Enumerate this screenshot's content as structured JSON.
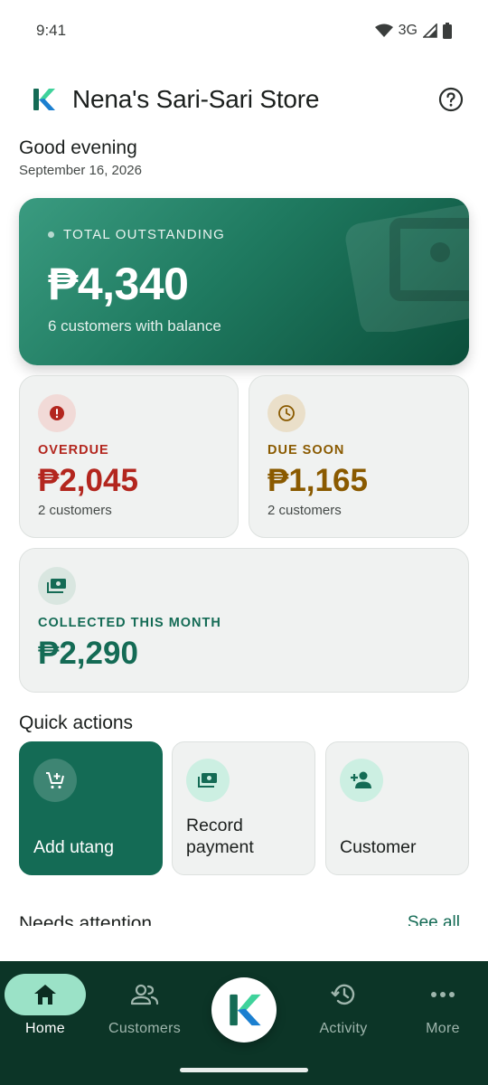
{
  "status_bar": {
    "time": "9:41",
    "network": "3G"
  },
  "header": {
    "title": "Nena's Sari-Sari Store",
    "logo_icon": "k-logo-icon",
    "help_icon": "help-circle-icon"
  },
  "greeting": {
    "text": "Good evening",
    "date": "September 16, 2026"
  },
  "total": {
    "label": "TOTAL OUTSTANDING",
    "amount": "₱4,340",
    "subtitle": "6 customers with balance"
  },
  "stats": {
    "overdue": {
      "label": "OVERDUE",
      "amount": "₱2,045",
      "subtitle": "2 customers",
      "color": "#b3261e",
      "icon": "alert-icon"
    },
    "due_soon": {
      "label": "DUE SOON",
      "amount": "₱1,165",
      "subtitle": "2 customers",
      "color": "#8a5a00",
      "icon": "clock-icon"
    },
    "collected": {
      "label": "COLLECTED THIS MONTH",
      "amount": "₱2,290",
      "color": "#146b55",
      "icon": "cash-icon"
    }
  },
  "quick_actions": {
    "title": "Quick actions",
    "items": [
      {
        "label": "Add utang",
        "icon": "cart-add-icon"
      },
      {
        "label": "Record payment",
        "icon": "payment-icon"
      },
      {
        "label": "Customer",
        "icon": "person-add-icon"
      }
    ]
  },
  "attention": {
    "title": "Needs attention",
    "see_all": "See all"
  },
  "nav": {
    "items": [
      {
        "label": "Home",
        "icon": "home-icon",
        "active": true
      },
      {
        "label": "Customers",
        "icon": "people-icon"
      },
      {
        "label": "Activity",
        "icon": "history-icon"
      },
      {
        "label": "More",
        "icon": "more-horizontal-icon"
      }
    ]
  },
  "colors": {
    "brand": "#146b55",
    "nav_bg": "#0c3527",
    "active_pill": "#9be2c7"
  }
}
